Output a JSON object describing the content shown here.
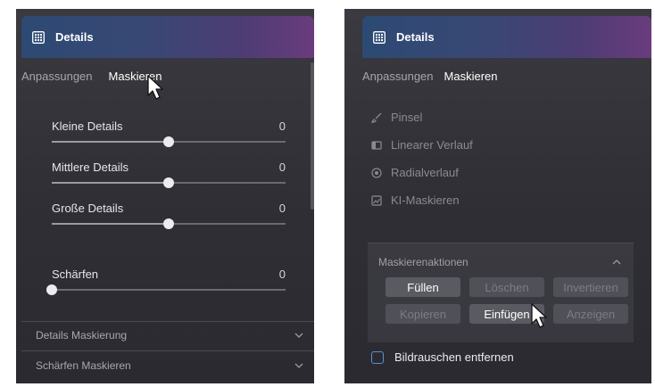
{
  "left": {
    "header": {
      "title": "Details"
    },
    "tabs": [
      {
        "label": "Anpassungen",
        "active": false
      },
      {
        "label": "Maskieren",
        "active": true
      }
    ],
    "sliders": [
      {
        "label": "Kleine Details",
        "value": "0",
        "level": 0.5
      },
      {
        "label": "Mittlere Details",
        "value": "0",
        "level": 0.5
      },
      {
        "label": "Große Details",
        "value": "0",
        "level": 0.5
      },
      {
        "label": "Schärfen",
        "value": "0",
        "level": 0.0
      }
    ],
    "sections": [
      {
        "label": "Details Maskierung"
      },
      {
        "label": "Schärfen Maskieren"
      }
    ]
  },
  "right": {
    "header": {
      "title": "Details"
    },
    "tabs": [
      {
        "label": "Anpassungen",
        "active": false
      },
      {
        "label": "Maskieren",
        "active": true
      }
    ],
    "tools": [
      {
        "label": "Pinsel",
        "icon": "brush-icon"
      },
      {
        "label": "Linearer Verlauf",
        "icon": "linear-gradient-icon"
      },
      {
        "label": "Radialverlauf",
        "icon": "radial-gradient-icon"
      },
      {
        "label": "KI-Maskieren",
        "icon": "ai-mask-icon"
      }
    ],
    "actions": {
      "title": "Maskierenaktionen",
      "buttons": [
        {
          "label": "Füllen",
          "enabled": true
        },
        {
          "label": "Löschen",
          "enabled": false
        },
        {
          "label": "Invertieren",
          "enabled": false
        },
        {
          "label": "Kopieren",
          "enabled": false
        },
        {
          "label": "Einfügen",
          "enabled": true
        },
        {
          "label": "Anzeigen",
          "enabled": false
        }
      ]
    },
    "checkbox": {
      "label": "Bildrauschen entfernen",
      "checked": false
    }
  },
  "colors": {
    "accent_blue": "#5a8fd6",
    "header_gradient_start": "#2c4a73",
    "header_gradient_end": "#6a3c7e",
    "panel_bg": "#333338"
  }
}
